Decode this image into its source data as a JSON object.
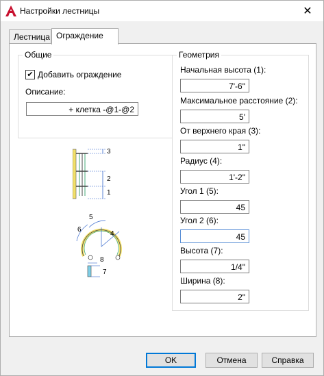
{
  "window": {
    "title": "Настройки лестницы",
    "icon": "autocad-a-icon",
    "close_glyph": "✕"
  },
  "tabs": [
    {
      "label": "Лестница",
      "active": false
    },
    {
      "label": "Ограждение",
      "active": true
    }
  ],
  "general": {
    "legend": "Общие",
    "add_railing": {
      "label": "Добавить ограждение",
      "checked": true
    },
    "description_label": "Описание:",
    "description_value": "+ клетка -@1-@2"
  },
  "geometry": {
    "legend": "Геометрия",
    "fields": [
      {
        "label": "Начальная высота (1):",
        "value": "7'-6\""
      },
      {
        "label": "Максимальное расстояние (2):",
        "value": "5'"
      },
      {
        "label": "От верхнего края (3):",
        "value": "1\""
      },
      {
        "label": "Радиус (4):",
        "value": "1'-2\""
      },
      {
        "label": "Угол 1 (5):",
        "value": "45"
      },
      {
        "label": "Угол 2 (6):",
        "value": "45"
      },
      {
        "label": "Высота (7):",
        "value": "1/4\""
      },
      {
        "label": "Ширина (8):",
        "value": "2\""
      }
    ]
  },
  "diagrams": {
    "side_labels": [
      "3",
      "2",
      "1"
    ],
    "plan_labels": [
      "5",
      "6",
      "4",
      "8",
      "7"
    ]
  },
  "buttons": {
    "ok": "OK",
    "cancel": "Отмена",
    "help": "Справка"
  },
  "colors": {
    "accent": "#0078d7",
    "app_red": "#c8102e"
  }
}
